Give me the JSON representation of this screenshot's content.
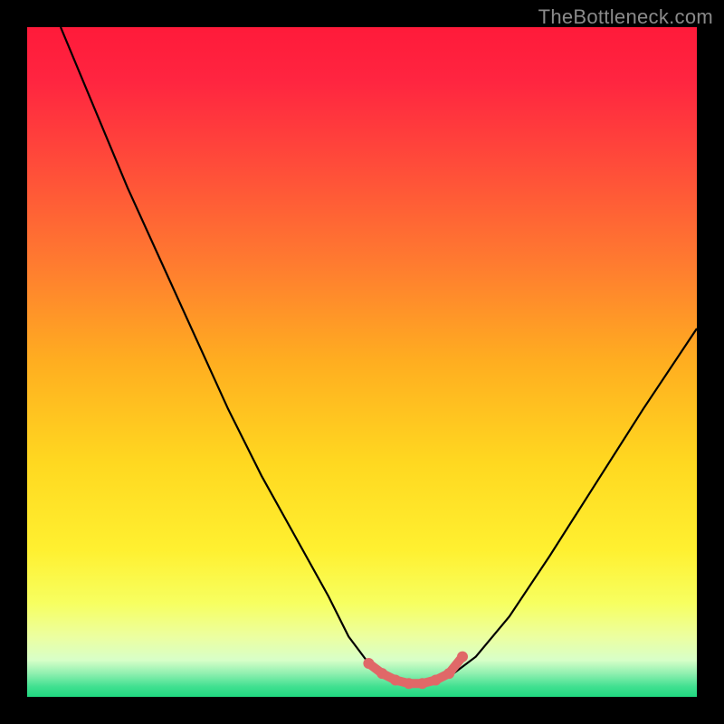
{
  "watermark": "TheBottleneck.com",
  "colors": {
    "gradient_stops": [
      {
        "offset": 0.0,
        "color": "#ff1a3a"
      },
      {
        "offset": 0.08,
        "color": "#ff2540"
      },
      {
        "offset": 0.2,
        "color": "#ff4a3a"
      },
      {
        "offset": 0.35,
        "color": "#ff7a30"
      },
      {
        "offset": 0.5,
        "color": "#ffae20"
      },
      {
        "offset": 0.65,
        "color": "#ffd820"
      },
      {
        "offset": 0.78,
        "color": "#fff030"
      },
      {
        "offset": 0.86,
        "color": "#f7ff60"
      },
      {
        "offset": 0.91,
        "color": "#ecffa0"
      },
      {
        "offset": 0.945,
        "color": "#d8ffc8"
      },
      {
        "offset": 0.965,
        "color": "#90f0b0"
      },
      {
        "offset": 0.985,
        "color": "#40e090"
      },
      {
        "offset": 1.0,
        "color": "#20d880"
      }
    ],
    "curve": "#000000",
    "markers": "#e06868"
  },
  "chart_data": {
    "type": "line",
    "title": "",
    "xlabel": "",
    "ylabel": "",
    "xlim": [
      0,
      100
    ],
    "ylim": [
      0,
      100
    ],
    "grid": false,
    "series": [
      {
        "name": "bottleneck-curve",
        "x": [
          5,
          10,
          15,
          20,
          25,
          30,
          35,
          40,
          45,
          48,
          51,
          54,
          57,
          60,
          63,
          67,
          72,
          78,
          85,
          92,
          100
        ],
        "y": [
          100,
          88,
          76,
          65,
          54,
          43,
          33,
          24,
          15,
          9,
          5,
          3,
          2,
          2,
          3,
          6,
          12,
          21,
          32,
          43,
          55
        ]
      }
    ],
    "markers": {
      "name": "optimal-range",
      "x": [
        51,
        53,
        55,
        57,
        59,
        61,
        63,
        65
      ],
      "y": [
        5,
        3.5,
        2.5,
        2,
        2,
        2.5,
        3.5,
        6
      ]
    }
  }
}
